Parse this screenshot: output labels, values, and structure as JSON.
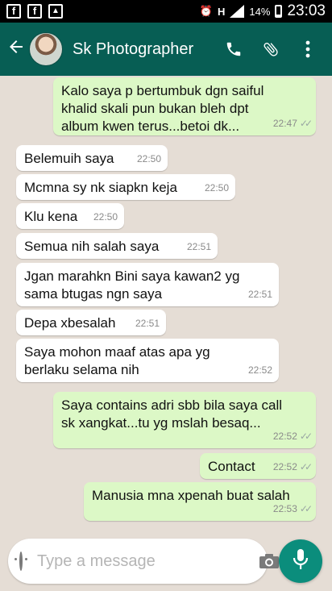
{
  "status_bar": {
    "left_icons": [
      "facebook-icon",
      "facebook-icon",
      "gallery-icon"
    ],
    "network": "H",
    "battery": "14%",
    "time": "23:03"
  },
  "header": {
    "contact_name": "Sk Photographer",
    "icons": [
      "back-arrow-icon",
      "phone-icon",
      "attachment-icon",
      "more-vert-icon"
    ]
  },
  "messages": [
    {
      "direction": "out",
      "text": "Kalo saya p bertumbuk dgn saiful khalid skali pun bukan bleh dpt album kwen terus...betoi dk...",
      "time": "22:47"
    },
    {
      "direction": "in",
      "text": "Belemuih saya",
      "time": "22:50"
    },
    {
      "direction": "in",
      "text": "Mcmna sy nk siapkn keja",
      "time": "22:50"
    },
    {
      "direction": "in",
      "text": "Klu kena",
      "time": "22:50"
    },
    {
      "direction": "in",
      "text": "Semua nih salah saya",
      "time": "22:51"
    },
    {
      "direction": "in",
      "text": "Jgan marahkn Bini saya kawan2 yg sama btugas ngn saya",
      "time": "22:51"
    },
    {
      "direction": "in",
      "text": "Depa xbesalah",
      "time": "22:51"
    },
    {
      "direction": "in",
      "text": "Saya mohon maaf atas apa yg berlaku selama nih",
      "time": "22:52"
    },
    {
      "direction": "out",
      "text": "Saya contains adri sbb bila saya call sk xangkat...tu yg mslah besaq...",
      "time": "22:52"
    },
    {
      "direction": "out",
      "text": "Contact",
      "time": "22:52"
    },
    {
      "direction": "out",
      "text": "Manusia mna xpenah buat salah",
      "time": "22:53"
    }
  ],
  "composer": {
    "placeholder": "Type a message"
  },
  "colors": {
    "header": "#075e54",
    "outgoing_bubble": "#dcf8c6",
    "incoming_bubble": "#ffffff",
    "chat_bg": "#e5ddd5",
    "fab": "#0b8d7c"
  }
}
